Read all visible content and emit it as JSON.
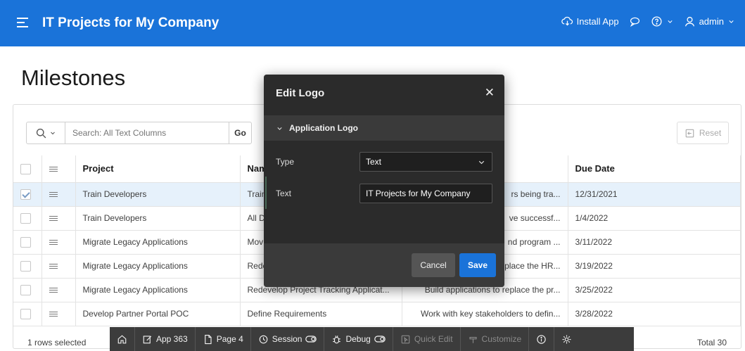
{
  "header": {
    "app_title": "IT Projects for My Company",
    "install_app": "Install App",
    "user": "admin"
  },
  "page_title": "Milestones",
  "toolbar": {
    "search_placeholder": "Search: All Text Columns",
    "go_label": "Go",
    "reset_label": "Reset"
  },
  "table": {
    "columns": [
      "Project",
      "Nam",
      "",
      "Due Date"
    ],
    "rows": [
      {
        "project": "Train Developers",
        "name": "Train",
        "desc": "rs being tra...",
        "due": "12/31/2021",
        "checked": true
      },
      {
        "project": "Train Developers",
        "name": "All D",
        "desc": "ve successf...",
        "due": "1/4/2022",
        "checked": false
      },
      {
        "project": "Migrate Legacy Applications",
        "name": "Mov",
        "desc": "nd program ...",
        "due": "3/11/2022",
        "checked": false
      },
      {
        "project": "Migrate Legacy Applications",
        "name": "Rede",
        "desc": "place the HR...",
        "due": "3/19/2022",
        "checked": false
      },
      {
        "project": "Migrate Legacy Applications",
        "name": "Redevelop Project Tracking Applicat...",
        "desc": "Build applications to replace the pr...",
        "due": "3/25/2022",
        "checked": false
      },
      {
        "project": "Develop Partner Portal POC",
        "name": "Define Requirements",
        "desc": "Work with key stakeholders to defin...",
        "due": "3/28/2022",
        "checked": false
      }
    ],
    "selection_status": "1 rows selected",
    "total": "Total 30"
  },
  "devbar": {
    "app": "App 363",
    "page": "Page 4",
    "session": "Session",
    "debug": "Debug",
    "quick_edit": "Quick Edit",
    "customize": "Customize"
  },
  "modal": {
    "title": "Edit Logo",
    "section": "Application Logo",
    "type_label": "Type",
    "type_value": "Text",
    "text_label": "Text",
    "text_value": "IT Projects for My Company",
    "cancel": "Cancel",
    "save": "Save"
  }
}
